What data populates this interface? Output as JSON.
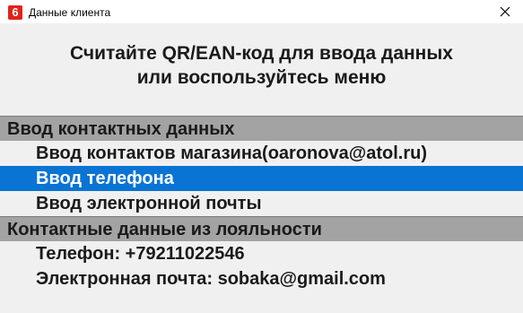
{
  "window": {
    "app_icon_glyph": "6",
    "title": "Данные клиента",
    "close_glyph": "✕",
    "icon_color": "#e2231a"
  },
  "instruction": {
    "line1": "Считайте QR/EAN-код для ввода данных",
    "line2": "или воспользуйтесь меню"
  },
  "menu": {
    "selection_color": "#0a74d4",
    "header_color": "#a3a3a3",
    "sections": [
      {
        "header": "Ввод контактных данных",
        "items": [
          {
            "label": "Ввод контактов магазина(oaronova@atol.ru)",
            "selected": false
          },
          {
            "label": "Ввод телефона",
            "selected": true
          },
          {
            "label": "Ввод электронной почты",
            "selected": false
          }
        ]
      },
      {
        "header": "Контактные данные из лояльности",
        "items": [
          {
            "label": "Телефон: +79211022546",
            "selected": false
          },
          {
            "label": "Электронная почта: sobaka@gmail.com",
            "selected": false
          }
        ]
      }
    ]
  }
}
